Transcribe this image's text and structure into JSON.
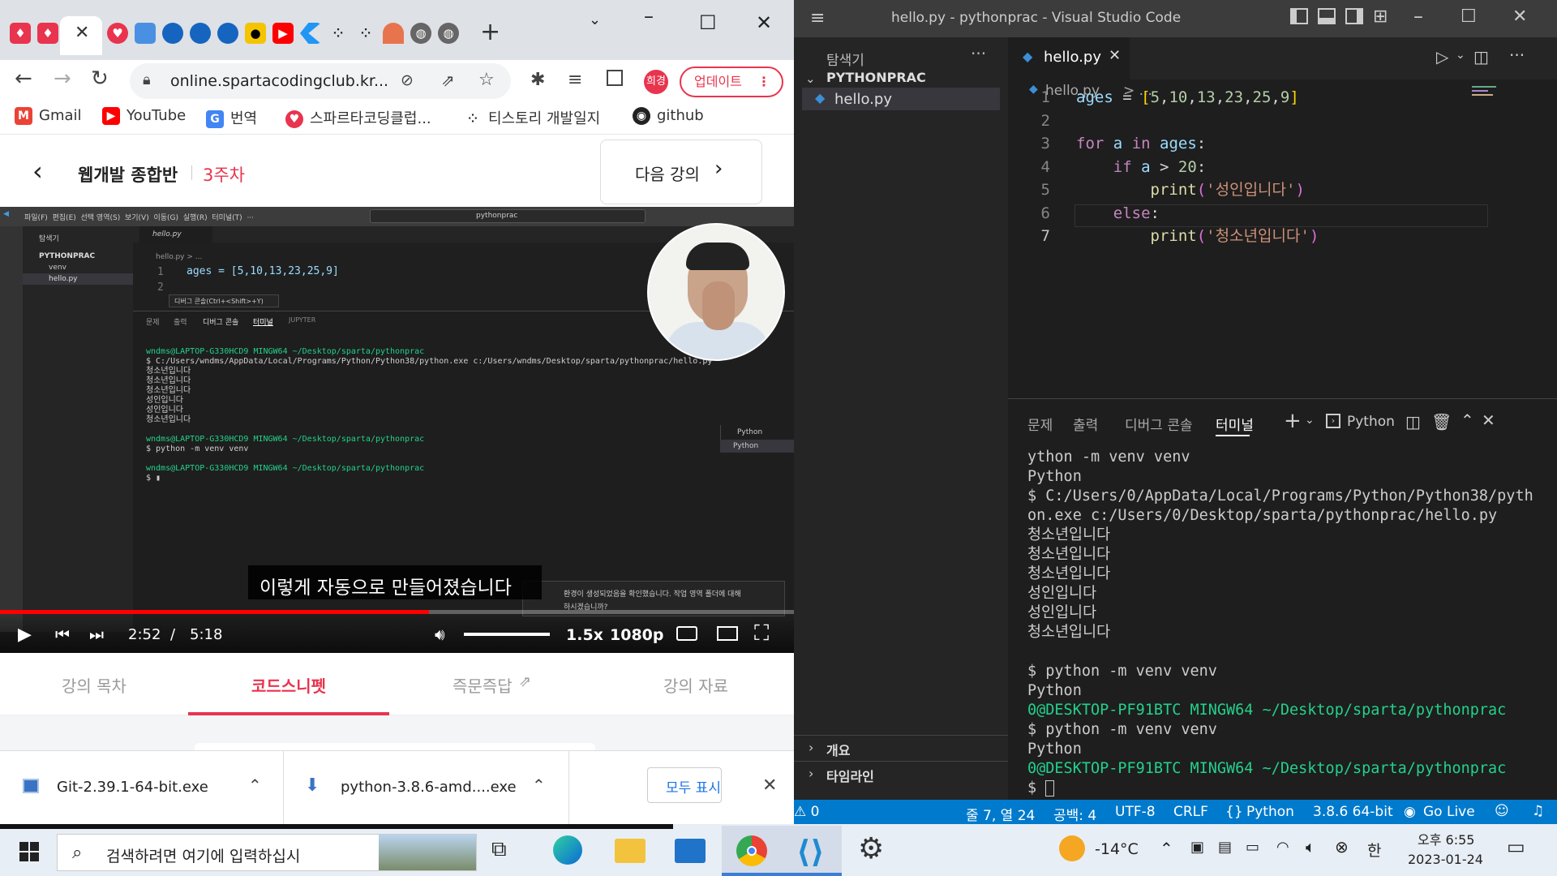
{
  "browser": {
    "tab_close": "✕",
    "address": "online.spartacodingclub.kr...",
    "profile": "희경",
    "update_button": "업데이트",
    "bookmarks": [
      {
        "label": "Gmail",
        "icon": "gmail-icon",
        "color": "#ea4335"
      },
      {
        "label": "YouTube",
        "icon": "youtube-icon",
        "color": "#ff0000"
      },
      {
        "label": "번역",
        "icon": "translate-icon",
        "color": "#4285f4"
      },
      {
        "label": "스파르타코딩클럽...",
        "icon": "sparta-icon",
        "color": "#e8344e"
      },
      {
        "label": "티스토리 개발일지",
        "icon": "tistory-icon",
        "color": "#222"
      },
      {
        "label": "github",
        "icon": "github-icon",
        "color": "#222"
      }
    ]
  },
  "lecture": {
    "title": "웹개발 종합반",
    "week": "3주차",
    "next_button": "다음 강의"
  },
  "video": {
    "menu": [
      "파일(F)",
      "편집(E)",
      "선택 영역(S)",
      "보기(V)",
      "이동(G)",
      "실행(R)",
      "터미널(T)",
      "···"
    ],
    "search": "pythonprac",
    "explorer_title": "탐색기",
    "project": "PYTHONPRAC",
    "files": [
      "venv",
      "hello.py"
    ],
    "tab": "hello.py",
    "breadcrumb": "hello.py > ...",
    "code_line1": "ages = [5,10,13,23,25,9]",
    "tooltip": "디버그 콘솔(Ctrl+<Shift>+Y)",
    "panel_tabs": [
      "문제",
      "출력",
      "디버그 콘솔",
      "터미널",
      "JUPYTER"
    ],
    "terminal": [
      "wndms@LAPTOP-G330HCD9 MINGW64 ~/Desktop/sparta/pythonprac",
      "$ C:/Users/wndms/AppData/Local/Programs/Python/Python38/python.exe c:/Users/wndms/Desktop/sparta/pythonprac/hello.py",
      "청소년입니다",
      "청소년입니다",
      "청소년입니다",
      "성인입니다",
      "성인입니다",
      "청소년입니다",
      "",
      "wndms@LAPTOP-G330HCD9 MINGW64 ~/Desktop/sparta/pythonprac",
      "$ python -m venv venv",
      "",
      "wndms@LAPTOP-G330HCD9 MINGW64 ~/Desktop/sparta/pythonprac",
      "$ "
    ],
    "terminal_list": [
      "Python",
      "Python"
    ],
    "notice": "환경이 생성되었음을 확인했습니다. 작업 영역 폴더에 대해",
    "notice2": "하시겠습니까?",
    "subtitle": "이렇게 자동으로 만들어졌습니다",
    "time_current": "2:52",
    "time_sep": "/",
    "time_total": "5:18",
    "speed": "1.5x",
    "quality": "1080p",
    "progress": 0.54
  },
  "page_tabs": [
    "강의 목차",
    "코드스니펫",
    "즉문즉답",
    "강의 자료"
  ],
  "downloads": {
    "items": [
      "Git-2.39.1-64-bit.exe",
      "python-3.8.6-amd....exe"
    ],
    "show_all": "모두 표시"
  },
  "vscode": {
    "title": "hello.py - pythonprac - Visual Studio Code",
    "explorer": "탐색기",
    "project": "PYTHONPRAC",
    "file": "hello.py",
    "outline": "개요",
    "timeline": "타임라인",
    "tab": "hello.py",
    "breadcrumb_file": "hello.py",
    "breadcrumb_rest": "> ...",
    "panel_tabs": [
      "문제",
      "출력",
      "디버그 콘솔",
      "터미널"
    ],
    "terminal_profile": "Python",
    "terminal": [
      "ython -m venv venv",
      "Python",
      "$ C:/Users/0/AppData/Local/Programs/Python/Python38/pyth",
      "on.exe c:/Users/0/Desktop/sparta/pythonprac/hello.py",
      "청소년입니다",
      "청소년입니다",
      "청소년입니다",
      "성인입니다",
      "성인입니다",
      "청소년입니다",
      "",
      "$ python -m venv venv",
      "Python",
      "0@DESKTOP-PF91BTC MINGW64 ~/Desktop/sparta/pythonprac",
      "$ python -m venv venv",
      "Python",
      "0@DESKTOP-PF91BTC MINGW64 ~/Desktop/sparta/pythonprac",
      "$ "
    ],
    "status": {
      "errors": "⚠ 0",
      "position": "줄 7, 열 24",
      "spaces": "공백: 4",
      "encoding": "UTF-8",
      "eol": "CRLF",
      "language": "Python",
      "interpreter": "3.8.6 64-bit",
      "golive": "Go Live"
    }
  },
  "taskbar": {
    "search": "검색하려면 여기에 입력하십시",
    "temp": "-14°C",
    "ime": "한",
    "time": "오후 6:55",
    "date": "2023-01-24"
  }
}
